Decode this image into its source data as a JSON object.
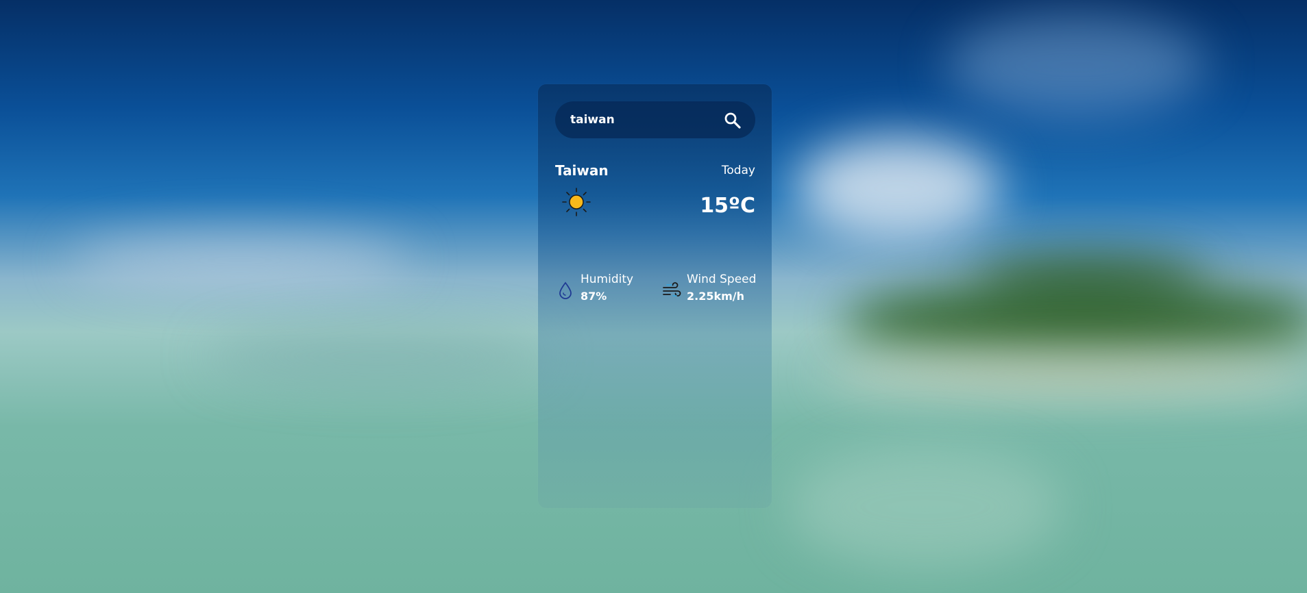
{
  "search": {
    "value": "taiwan",
    "icon": "search-icon"
  },
  "weather": {
    "city": "Taiwan",
    "day_label": "Today",
    "condition_icon": "sun-icon",
    "temperature": "15ºC"
  },
  "details": {
    "humidity": {
      "label": "Humidity",
      "value": "87%",
      "icon": "humidity-drop-icon"
    },
    "wind": {
      "label": "Wind Speed",
      "value": "2.25km/h",
      "icon": "wind-icon"
    }
  },
  "colors": {
    "sun": "#f8b91b",
    "drop": "#1f3a93",
    "text": "#ffffff"
  }
}
